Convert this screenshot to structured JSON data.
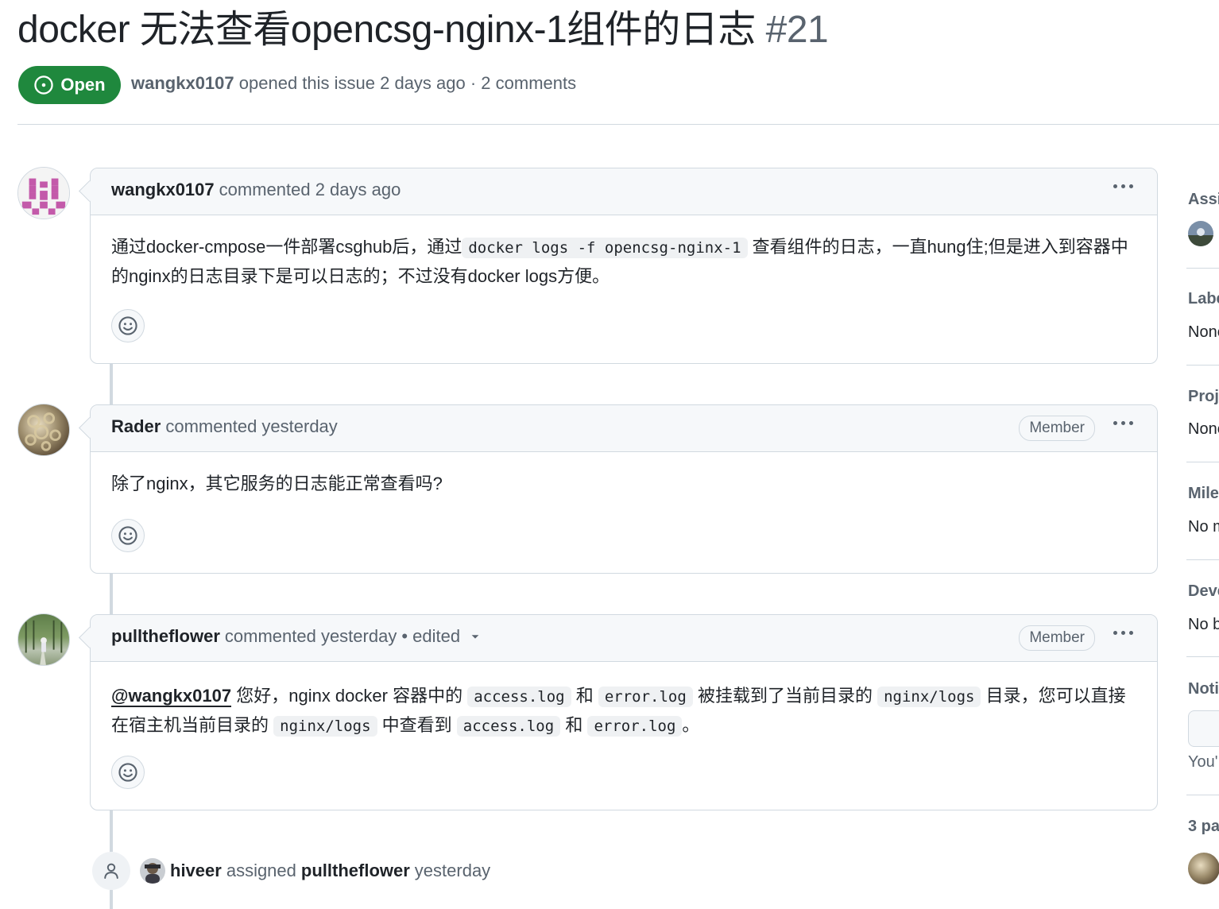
{
  "issue": {
    "title": "docker 无法查看opencsg-nginx-1组件的日志",
    "number": "#21",
    "state": "Open",
    "author": "wangkx0107",
    "opened_text": "opened this issue 2 days ago · 2 comments"
  },
  "comments": [
    {
      "author": "wangkx0107",
      "meta": "commented 2 days ago",
      "body": {
        "p1": "通过docker-cmpose一件部署csghub后，通过",
        "code1": "docker logs -f opencsg-nginx-1",
        "p2": "查看组件的日志，一直hung住;但是进入到容器中的nginx的日志目录下是可以日志的；不过没有docker logs方便。"
      }
    },
    {
      "author": "Rader",
      "meta": "commented yesterday",
      "role": "Member",
      "body": {
        "p1": "除了nginx，其它服务的日志能正常查看吗?"
      }
    },
    {
      "author": "pulltheflower",
      "meta": "commented yesterday",
      "edited": "• edited",
      "role": "Member",
      "body": {
        "mention": "@wangkx0107",
        "t1": "您好，nginx docker 容器中的",
        "c1": "access.log",
        "t2": "和",
        "c2": "error.log",
        "t3": "被挂载到了当前目录的",
        "c3": "nginx/logs",
        "t4": "目录，您可以直接在宿主机当前目录的",
        "c4": "nginx/logs",
        "t5": "中查看到",
        "c5": "access.log",
        "t6": "和",
        "c6": "error.log",
        "t7": "。"
      }
    }
  ],
  "event": {
    "actor": "hiveer",
    "action": "assigned",
    "target": "pulltheflower",
    "time": "yesterday"
  },
  "sidebar": {
    "assignees_label": "Assi",
    "labels_label": "Labe",
    "labels_value": "None",
    "projects_label": "Proj",
    "projects_value": "None",
    "milestone_label": "Mile",
    "milestone_value": "No m",
    "development_label": "Deve",
    "development_value": "No b",
    "notifications_label": "Noti",
    "notifications_note": "You'",
    "participants_label": "3 pa"
  },
  "colors": {
    "open_green": "#1f883d",
    "border": "#d1d9e0",
    "muted_text": "#59636e",
    "header_bg": "#f6f8fa"
  }
}
